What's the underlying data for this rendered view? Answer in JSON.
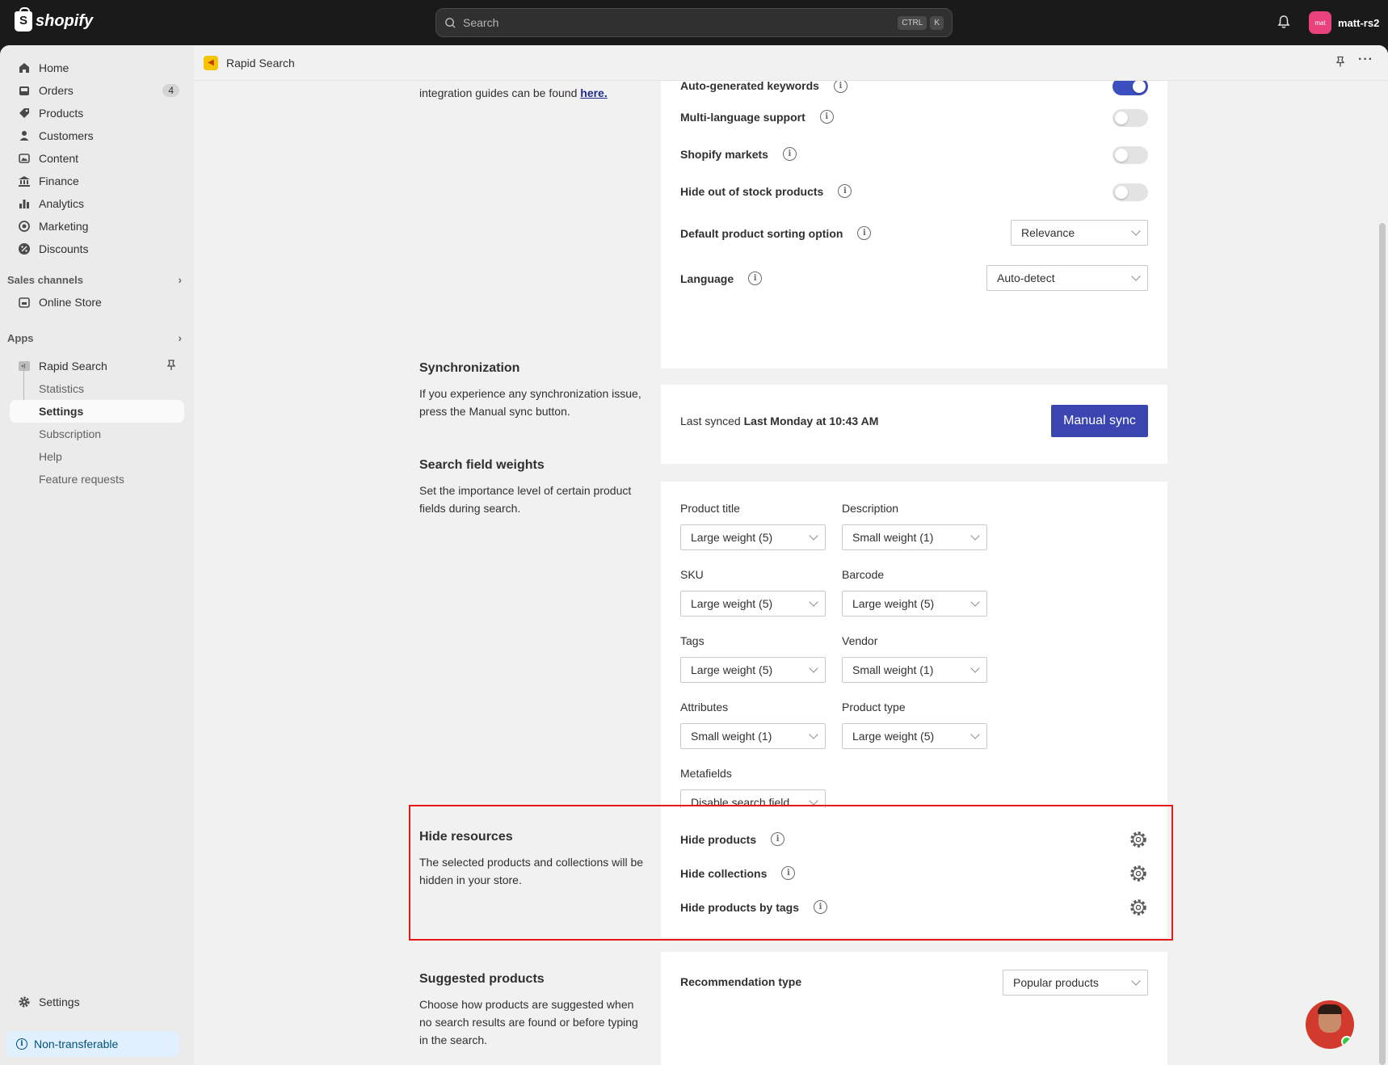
{
  "topbar": {
    "brand": "shopify",
    "search_placeholder": "Search",
    "kbd_ctrl": "CTRL",
    "kbd_k": "K",
    "avatar_initials": "mat",
    "account_name": "matt-rs2"
  },
  "sidebar": {
    "items": [
      {
        "label": "Home",
        "icon": "home-icon"
      },
      {
        "label": "Orders",
        "icon": "orders-icon",
        "badge": "4"
      },
      {
        "label": "Products",
        "icon": "tag-icon"
      },
      {
        "label": "Customers",
        "icon": "person-icon"
      },
      {
        "label": "Content",
        "icon": "content-icon"
      },
      {
        "label": "Finance",
        "icon": "bank-icon"
      },
      {
        "label": "Analytics",
        "icon": "bar-chart-icon"
      },
      {
        "label": "Marketing",
        "icon": "target-icon"
      },
      {
        "label": "Discounts",
        "icon": "discount-icon"
      }
    ],
    "sales_channels_label": "Sales channels",
    "online_store_label": "Online Store",
    "apps_label": "Apps",
    "rapid_search_label": "Rapid Search",
    "app_subitems": [
      "Statistics",
      "Settings",
      "Subscription",
      "Help",
      "Feature requests"
    ],
    "settings_label": "Settings",
    "non_transferable_label": "Non-transferable"
  },
  "app_header": {
    "title": "Rapid Search"
  },
  "general": {
    "desc_line": "integration guides can be found",
    "desc_link": "here.",
    "rows": [
      {
        "label": "Auto-generated keywords",
        "on": true
      },
      {
        "label": "Multi-language support",
        "on": false
      },
      {
        "label": "Shopify markets",
        "on": false
      },
      {
        "label": "Hide out of stock products",
        "on": false
      }
    ],
    "sorting_label": "Default product sorting option",
    "sorting_value": "Relevance",
    "language_label": "Language",
    "language_value": "Auto-detect"
  },
  "sync": {
    "title": "Synchronization",
    "desc": "If you experience any synchronization issue, press the Manual sync button.",
    "last_synced_prefix": "Last synced",
    "last_synced_value": "Last Monday at 10:43 AM",
    "button": "Manual sync"
  },
  "weights": {
    "title": "Search field weights",
    "desc": "Set the importance level of certain product fields during search.",
    "fields": [
      {
        "label": "Product title",
        "value": "Large weight (5)"
      },
      {
        "label": "Description",
        "value": "Small weight (1)"
      },
      {
        "label": "SKU",
        "value": "Large weight (5)"
      },
      {
        "label": "Barcode",
        "value": "Large weight (5)"
      },
      {
        "label": "Tags",
        "value": "Large weight (5)"
      },
      {
        "label": "Vendor",
        "value": "Small weight (1)"
      },
      {
        "label": "Attributes",
        "value": "Small weight (1)"
      },
      {
        "label": "Product type",
        "value": "Large weight (5)"
      },
      {
        "label": "Metafields",
        "value": "Disable search field"
      }
    ]
  },
  "hide": {
    "title": "Hide resources",
    "desc": "The selected products and collections will be hidden in your store.",
    "rows": [
      "Hide products",
      "Hide collections",
      "Hide products by tags"
    ]
  },
  "suggested": {
    "title": "Suggested products",
    "desc": "Choose how products are suggested when no search results are found or before typing in the search.",
    "rec_label": "Recommendation type",
    "rec_value": "Popular products"
  },
  "colors": {
    "accent": "#3b45b0",
    "highlight": "#e21a1a"
  }
}
